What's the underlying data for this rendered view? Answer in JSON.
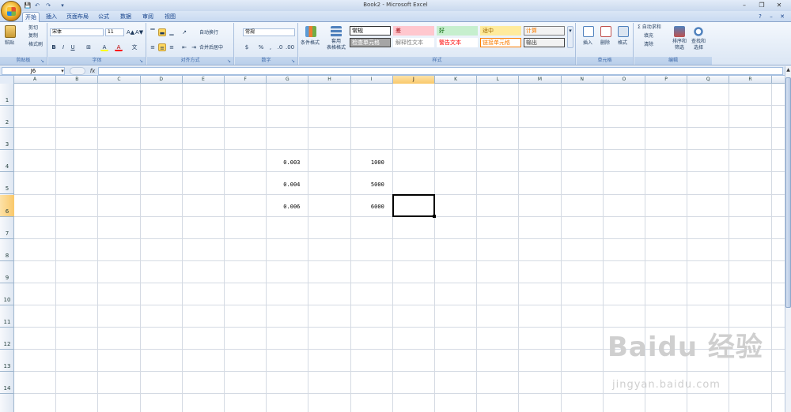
{
  "window": {
    "title": "Book2 - Microsoft Excel"
  },
  "qat": {
    "save": "💾",
    "undo": "↶",
    "redo": "↷",
    "more": "▾"
  },
  "window_controls": {
    "minimize": "–",
    "restore": "❐",
    "close": "✕"
  },
  "tabs": [
    "开始",
    "插入",
    "页面布局",
    "公式",
    "数据",
    "审阅",
    "视图"
  ],
  "ribbon": {
    "clipboard": {
      "label": "剪贴板",
      "paste": "粘贴",
      "cut": "剪切",
      "copy": "复制",
      "format_painter": "格式刷"
    },
    "font": {
      "label": "字体",
      "name": "宋体",
      "size": "11",
      "grow": "A▲",
      "shrink": "A▼",
      "bold": "B",
      "italic": "I",
      "underline": "U",
      "border": "⊞",
      "fill": "A",
      "color": "A",
      "wen": "文"
    },
    "alignment": {
      "label": "对齐方式",
      "wrap": "自动换行",
      "merge": "合并后居中"
    },
    "number": {
      "label": "数字",
      "format": "常规",
      "currency": "$",
      "percent": "%",
      "comma": ",",
      "inc": ".0",
      "dec": ".00"
    },
    "styles": {
      "label": "样式",
      "conditional": "条件格式",
      "table": "套用\n表格格式",
      "cells": [
        {
          "text": "常规",
          "bg": "#ffffff",
          "fg": "#000000",
          "border": "#333333"
        },
        {
          "text": "差",
          "bg": "#ffc7ce",
          "fg": "#9c0006",
          "border": "#ffc7ce"
        },
        {
          "text": "好",
          "bg": "#c6efce",
          "fg": "#006100",
          "border": "#c6efce"
        },
        {
          "text": "适中",
          "bg": "#ffeb9c",
          "fg": "#9c6500",
          "border": "#ffeb9c"
        },
        {
          "text": "计算",
          "bg": "#f2f2f2",
          "fg": "#fa7d00",
          "border": "#7f7f7f"
        },
        {
          "text": "检查单元格",
          "bg": "#a5a5a5",
          "fg": "#ffffff",
          "border": "#3f3f3f"
        },
        {
          "text": "解释性文本",
          "bg": "#ffffff",
          "fg": "#7f7f7f",
          "border": "#ffffff"
        },
        {
          "text": "警告文本",
          "bg": "#ffffff",
          "fg": "#ff0000",
          "border": "#ffffff"
        },
        {
          "text": "链接单元格",
          "bg": "#ffffff",
          "fg": "#fa7d00",
          "border": "#fa7d00"
        },
        {
          "text": "输出",
          "bg": "#f2f2f2",
          "fg": "#3f3f3f",
          "border": "#3f3f3f"
        }
      ]
    },
    "cells_group": {
      "label": "单元格",
      "insert": "插入",
      "delete": "删除",
      "format": "格式"
    },
    "editing": {
      "label": "编辑",
      "autosum": "Σ 自动求和",
      "fill": "填充",
      "clear": "清除",
      "sort": "排序和\n筛选",
      "find": "查找和\n选择"
    }
  },
  "formula_bar": {
    "name_box": "J6",
    "fx": "fx"
  },
  "columns": [
    "A",
    "B",
    "C",
    "D",
    "E",
    "F",
    "G",
    "H",
    "I",
    "J",
    "K",
    "L",
    "M",
    "N",
    "O",
    "P",
    "Q",
    "R"
  ],
  "rows": [
    "1",
    "2",
    "3",
    "4",
    "5",
    "6",
    "7",
    "8",
    "9",
    "10",
    "11",
    "12",
    "13",
    "14"
  ],
  "cells": [
    {
      "col": "G",
      "row": 4,
      "value": "0.003"
    },
    {
      "col": "I",
      "row": 4,
      "value": "1000"
    },
    {
      "col": "G",
      "row": 5,
      "value": "0.004"
    },
    {
      "col": "I",
      "row": 5,
      "value": "5000"
    },
    {
      "col": "G",
      "row": 6,
      "value": "0.006"
    },
    {
      "col": "I",
      "row": 6,
      "value": "6000"
    }
  ],
  "selected": {
    "col": "J",
    "row": 6
  },
  "watermark": {
    "main": "Baidu 经验",
    "sub": "jingyan.baidu.com"
  },
  "colors": {
    "accent": "#15428b",
    "ribbon_bg": "#dbe6f4",
    "selected_header": "#f9c86a"
  }
}
